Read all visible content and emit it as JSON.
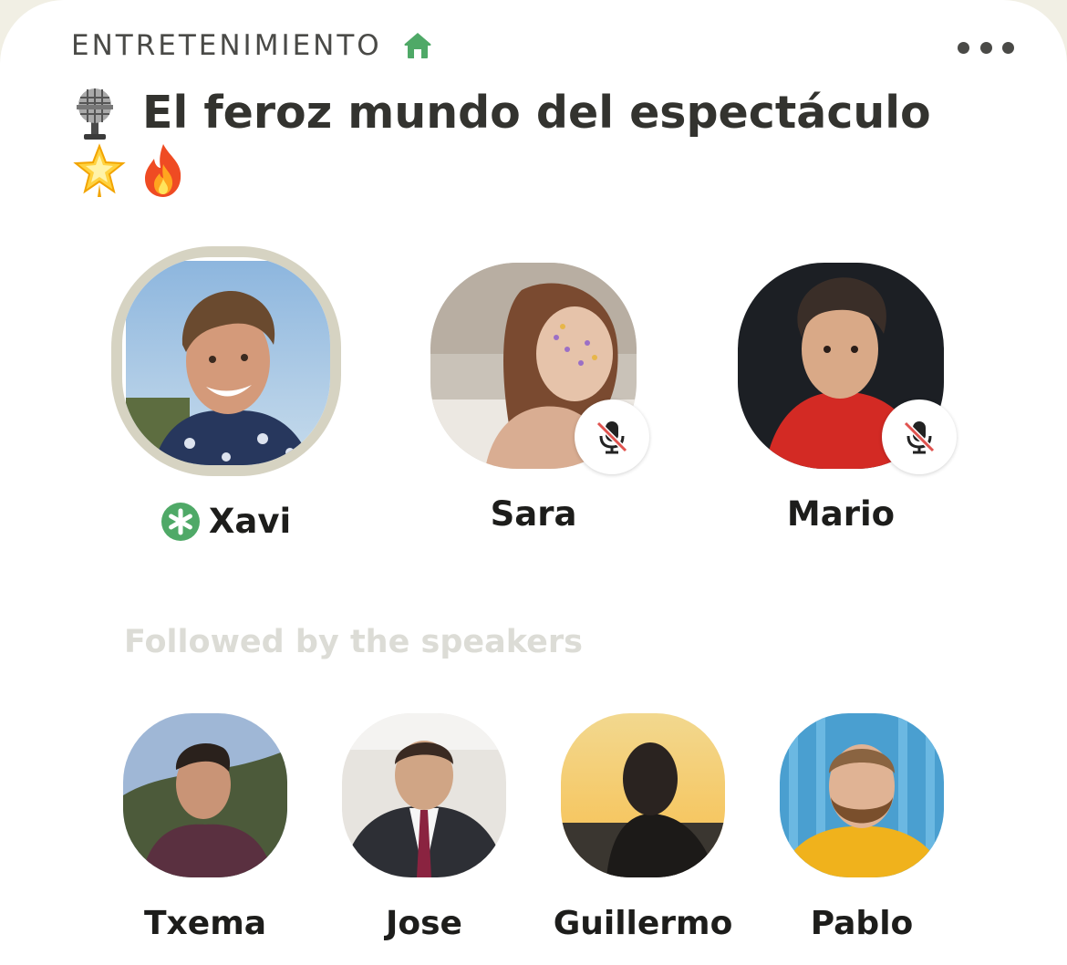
{
  "club": {
    "name": "ENTRETENIMIENTO",
    "icon": "house-icon",
    "accent": "#4fa967"
  },
  "room": {
    "title": "El feroz mundo del espectáculo",
    "title_icon": "microphone-emoji",
    "emojis": [
      "glowing-star-emoji",
      "fire-emoji"
    ]
  },
  "menu": {
    "icon": "more-options-icon"
  },
  "speakers": [
    {
      "name": "Xavi",
      "moderator": true,
      "speaking": true,
      "muted": false
    },
    {
      "name": "Sara",
      "moderator": false,
      "speaking": false,
      "muted": true
    },
    {
      "name": "Mario",
      "moderator": false,
      "speaking": false,
      "muted": true
    }
  ],
  "section": {
    "followed_label": "Followed by the speakers"
  },
  "listeners": [
    {
      "name": "Txema"
    },
    {
      "name": "Jose"
    },
    {
      "name": "Guillermo"
    },
    {
      "name": "Pablo"
    }
  ],
  "colors": {
    "speaking_ring": "#d6d3c2",
    "mute_red": "#e0534f",
    "section_label": "#dcdcd6"
  }
}
